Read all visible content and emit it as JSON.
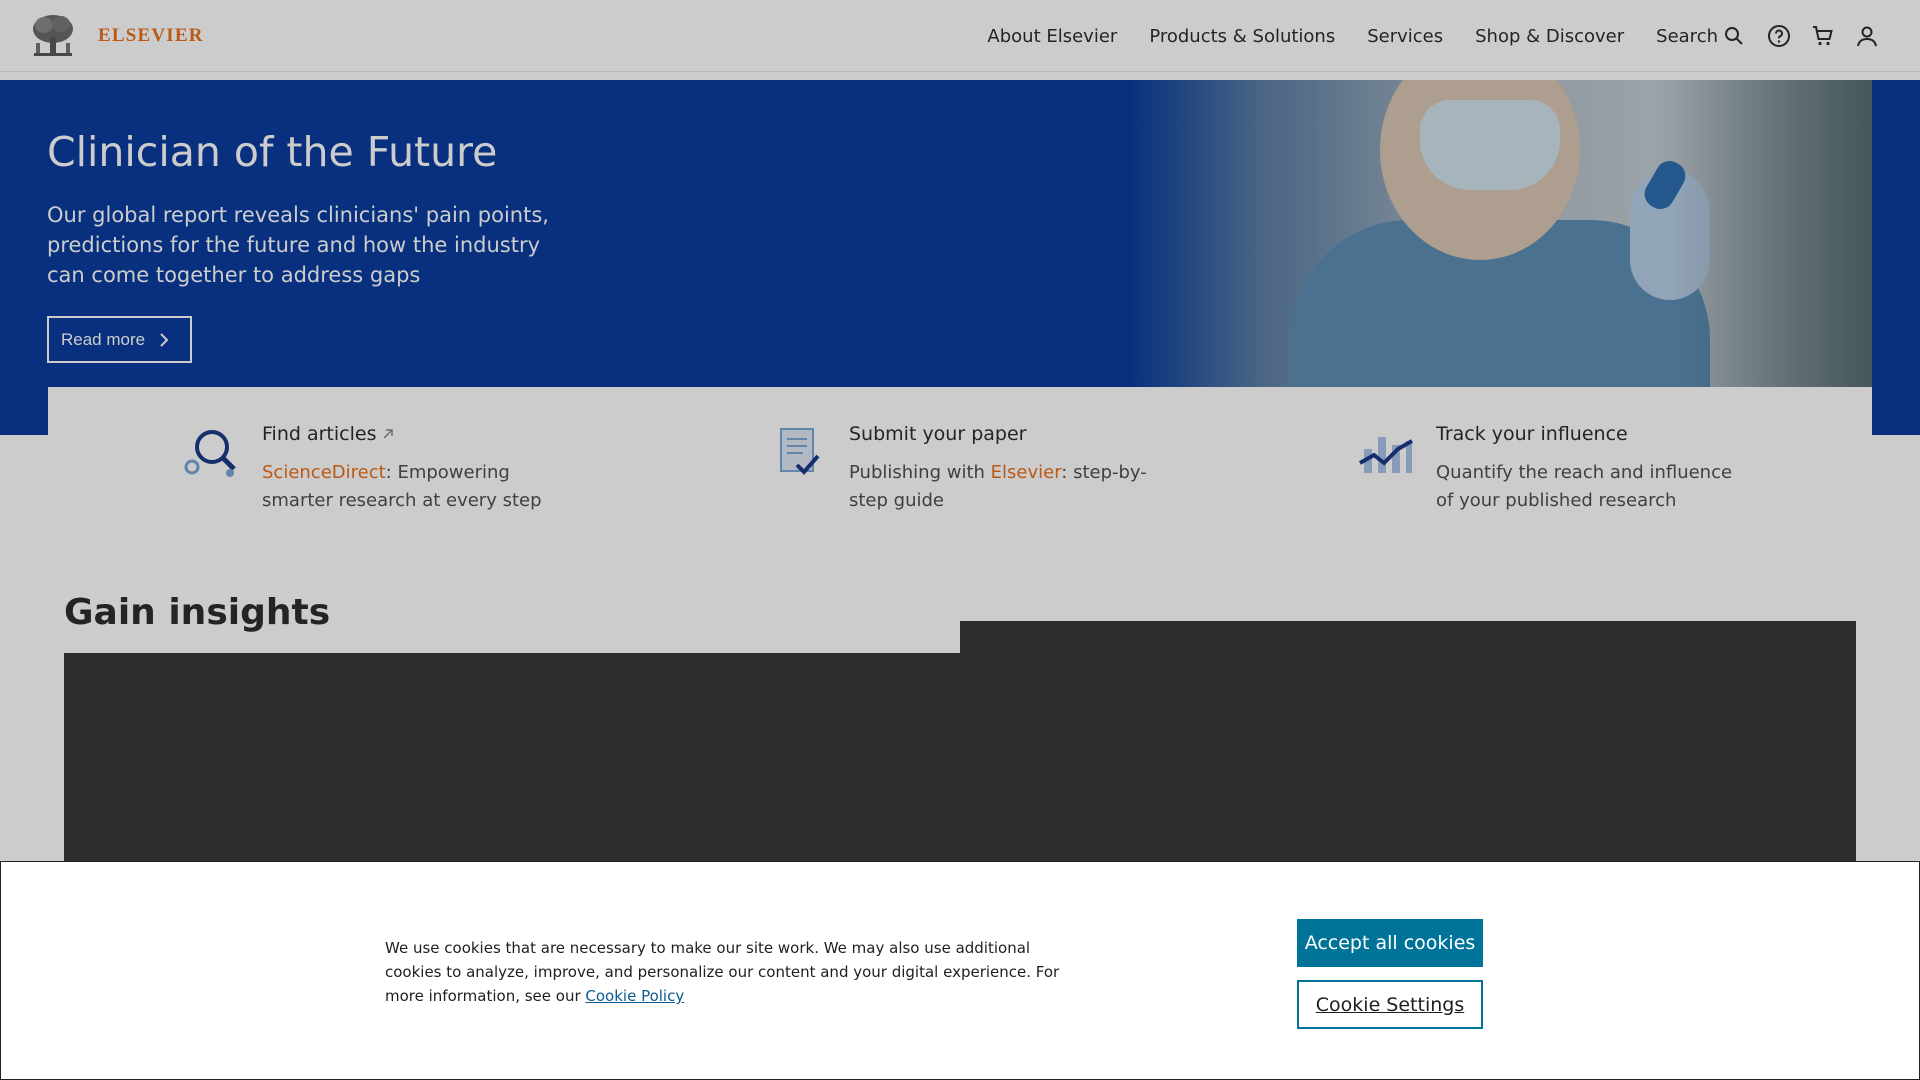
{
  "header": {
    "logo_text": "ELSEVIER",
    "nav": [
      "About Elsevier",
      "Products & Solutions",
      "Services",
      "Shop & Discover"
    ],
    "search_label": "Search",
    "icons": [
      "search-icon",
      "help-icon",
      "cart-icon",
      "user-icon"
    ]
  },
  "hero": {
    "title": "Clinician of the Future",
    "description": "Our global report reveals clinicians' pain points, predictions for the future and how the industry can come together to address gaps",
    "button_label": "Read more"
  },
  "features": [
    {
      "icon": "magnifier-icon",
      "title": "Find articles",
      "desc_highlight": "ScienceDirect",
      "desc_rest": ": Empowering smarter research at every step"
    },
    {
      "icon": "document-check-icon",
      "title": "Submit your paper",
      "desc_pre": "Publishing with ",
      "desc_highlight": "Elsevier",
      "desc_rest": ": step-by-step guide"
    },
    {
      "icon": "chart-trend-icon",
      "title": "Track your influence",
      "desc_rest": "Quantify the reach and influence of your published research"
    }
  ],
  "insights": {
    "title": "Gain insights"
  },
  "cookie": {
    "text": "We use cookies that are necessary to make our site work. We may also use additional cookies to analyze, improve, and personalize our content and your digital experience. For more information, see our ",
    "link_text": "Cookie Policy",
    "accept_label": "Accept all cookies",
    "settings_label": "Cookie Settings"
  },
  "colors": {
    "hero_blue": "#0a3d9e",
    "brand_orange": "#e9711c",
    "cookie_teal": "#007398"
  }
}
